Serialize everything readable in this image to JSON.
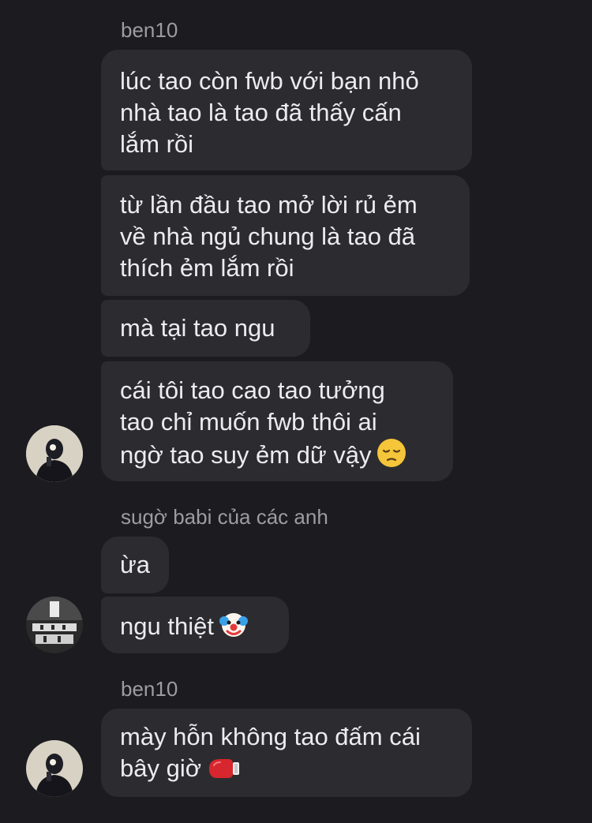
{
  "groups": [
    {
      "sender": "ben10",
      "messages": [
        {
          "lines": [
            "lúc tao còn fwb với bạn nhỏ",
            "nhà tao là tao đã thấy cấn",
            "lắm rồi"
          ]
        },
        {
          "lines": [
            "từ lần đầu tao mở lời rủ ẻm",
            "về nhà ngủ chung là tao đã",
            "thích ẻm lắm rồi"
          ]
        },
        {
          "lines": [
            "mà tại tao ngu"
          ]
        },
        {
          "lines": [
            "cái tôi tao cao tao tưởng",
            "tao chỉ muốn fwb thôi ai",
            "ngờ tao suy ẻm dữ vậy"
          ],
          "emoji": "pensive-face"
        }
      ],
      "avatar": "avatar-ben10"
    },
    {
      "sender": "sugờ babi của các anh",
      "messages": [
        {
          "lines": [
            "ừa"
          ]
        },
        {
          "lines": [
            "ngu thiệt"
          ],
          "emoji": "clown-face"
        }
      ],
      "avatar": "avatar-sugo-babi"
    },
    {
      "sender": "ben10",
      "messages": [
        {
          "lines": [
            "mày hỗn không tao đấm cái",
            "bây giờ"
          ],
          "emoji": "boxing-glove"
        }
      ],
      "avatar": "avatar-ben10"
    }
  ],
  "colors": {
    "background": "#1b1b20",
    "bubble": "#2c2c30",
    "message_text": "#ececef",
    "sender_text": "#9c9ca3"
  }
}
